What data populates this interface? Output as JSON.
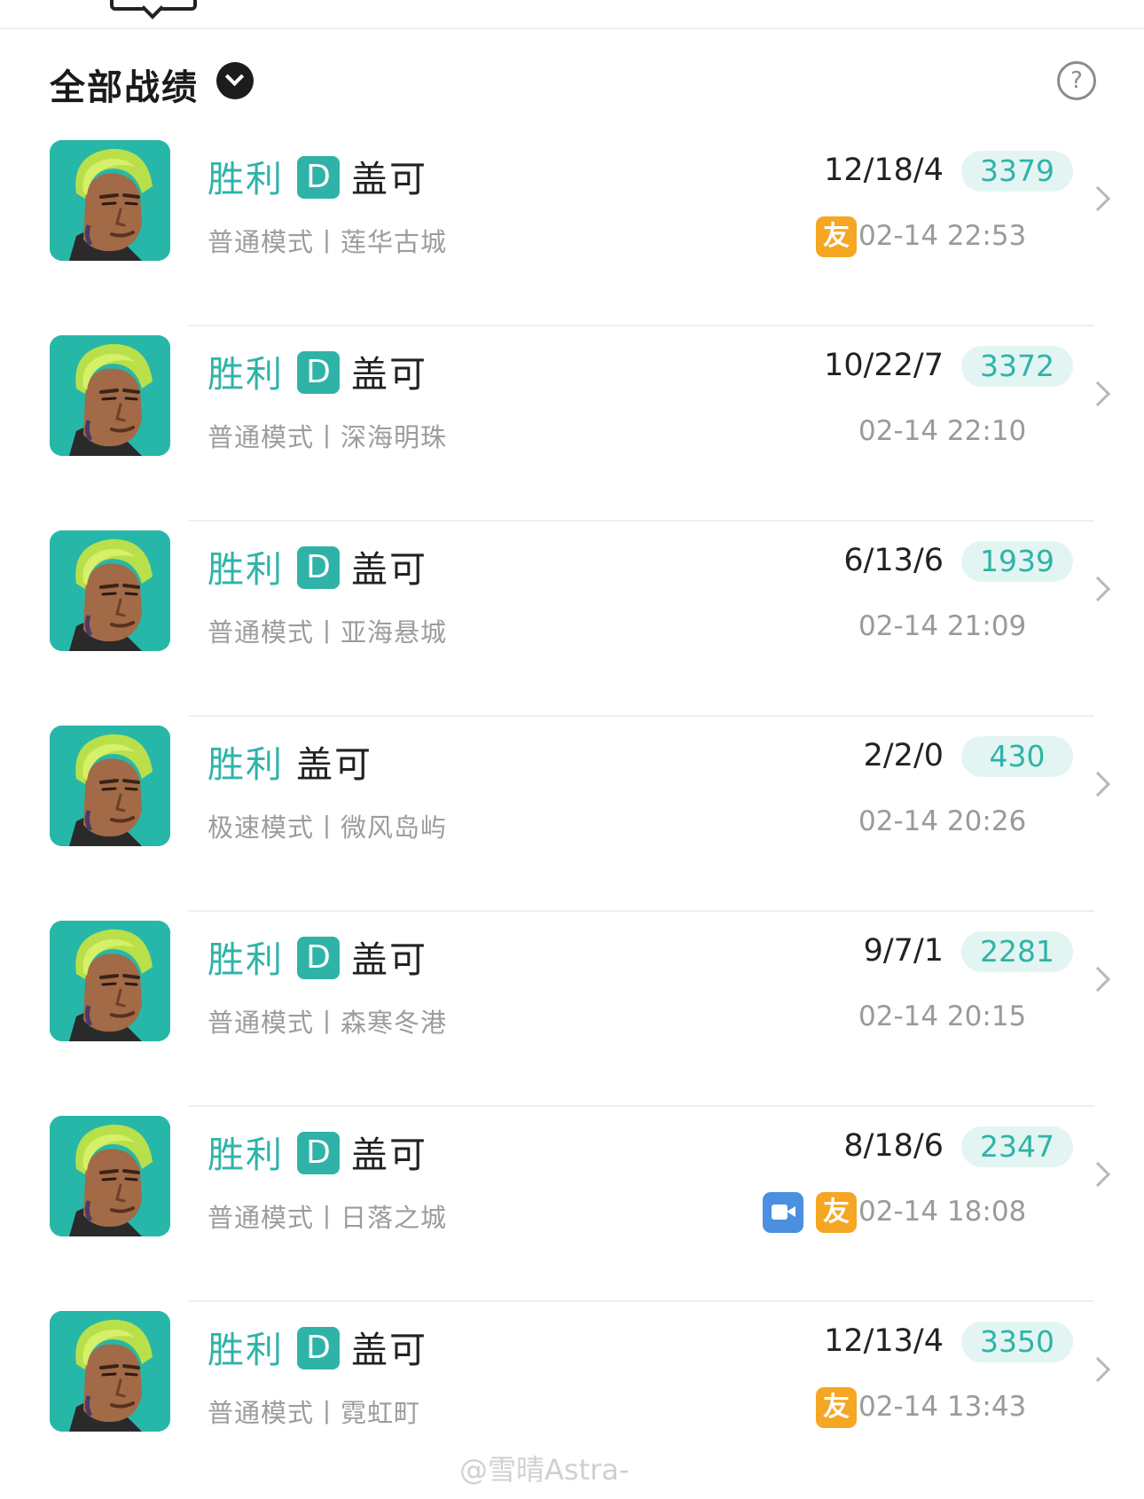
{
  "header": {
    "title": "全部战绩"
  },
  "matches": [
    {
      "result": "胜利",
      "grade": "D",
      "hero": "盖可",
      "mode": "普通模式丨莲华古城",
      "kda": "12/18/4",
      "score": "3379",
      "time": "02-14 22:53",
      "badges": [
        "friend"
      ]
    },
    {
      "result": "胜利",
      "grade": "D",
      "hero": "盖可",
      "mode": "普通模式丨深海明珠",
      "kda": "10/22/7",
      "score": "3372",
      "time": "02-14 22:10",
      "badges": []
    },
    {
      "result": "胜利",
      "grade": "D",
      "hero": "盖可",
      "mode": "普通模式丨亚海悬城",
      "kda": "6/13/6",
      "score": "1939",
      "time": "02-14 21:09",
      "badges": []
    },
    {
      "result": "胜利",
      "grade": "",
      "hero": "盖可",
      "mode": "极速模式丨微风岛屿",
      "kda": "2/2/0",
      "score": "430",
      "time": "02-14 20:26",
      "badges": []
    },
    {
      "result": "胜利",
      "grade": "D",
      "hero": "盖可",
      "mode": "普通模式丨森寒冬港",
      "kda": "9/7/1",
      "score": "2281",
      "time": "02-14 20:15",
      "badges": []
    },
    {
      "result": "胜利",
      "grade": "D",
      "hero": "盖可",
      "mode": "普通模式丨日落之城",
      "kda": "8/18/6",
      "score": "2347",
      "time": "02-14 18:08",
      "badges": [
        "video",
        "friend"
      ]
    },
    {
      "result": "胜利",
      "grade": "D",
      "hero": "盖可",
      "mode": "普通模式丨霓虹町",
      "kda": "12/13/4",
      "score": "3350",
      "time": "02-14 13:43",
      "badges": [
        "friend"
      ]
    }
  ],
  "badge_labels": {
    "friend": "友"
  },
  "watermark": "@雪晴Astra-",
  "colors": {
    "accent": "#2fb3a8",
    "score_bg": "#e3f5f2",
    "friend_badge": "#f5a623",
    "video_badge": "#4a8fe0",
    "avatar_bg": "#27b7a9"
  }
}
